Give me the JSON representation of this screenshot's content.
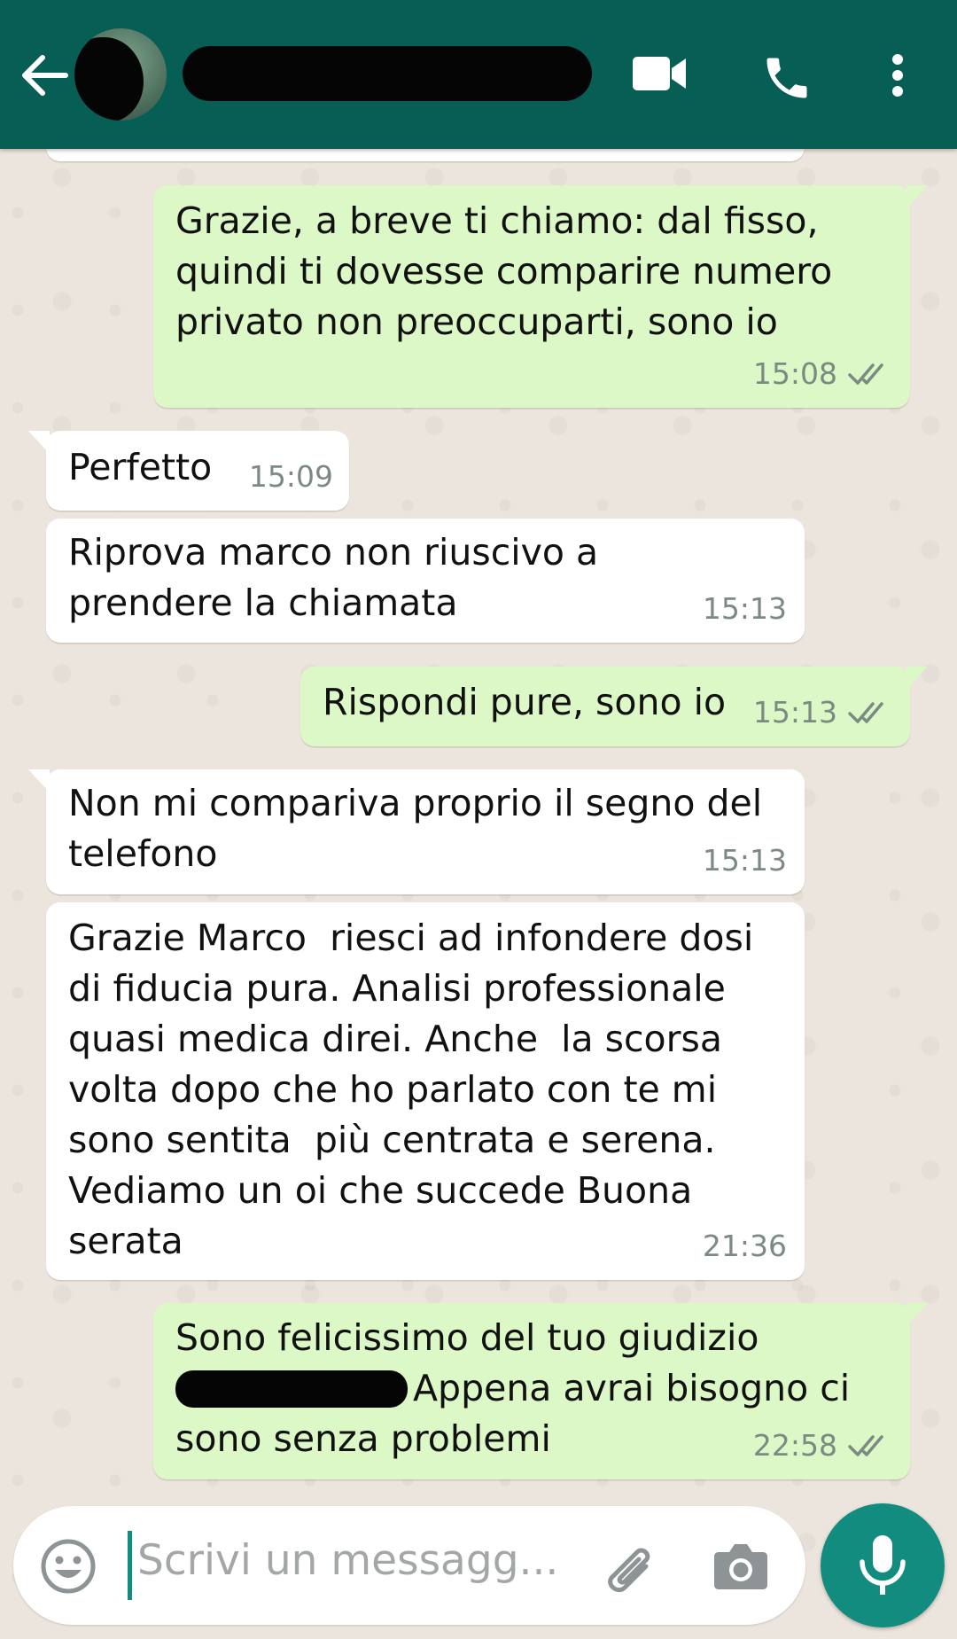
{
  "header": {
    "back_icon": "arrow-back-icon",
    "video_icon": "video-call-icon",
    "call_icon": "phone-icon",
    "menu_icon": "more-vert-icon",
    "colors": {
      "bar": "#075e54",
      "icon": "#ffffff"
    }
  },
  "messages": [
    {
      "direction": "out",
      "lines": [
        "Grazie, a breve ti chiamo: dal fisso,",
        "quindi ti dovesse comparire numero",
        "privato non preoccuparti, sono io"
      ],
      "time": "15:08",
      "status": "read"
    },
    {
      "direction": "in",
      "lines": [
        "Perfetto"
      ],
      "time": "15:09"
    },
    {
      "direction": "in",
      "lines": [
        "Riprova marco non riuscivo a",
        "prendere la chiamata"
      ],
      "time": "15:13"
    },
    {
      "direction": "out",
      "lines": [
        "Rispondi pure, sono io"
      ],
      "time": "15:13",
      "status": "read"
    },
    {
      "direction": "in",
      "lines": [
        "Non mi compariva proprio il segno del",
        "telefono"
      ],
      "time": "15:13"
    },
    {
      "direction": "in",
      "lines": [
        "Grazie Marco  riesci ad infondere dosi",
        "di fiducia pura. Analisi professionale",
        "quasi medica direi. Anche  la scorsa",
        "volta dopo che ho parlato con te mi",
        "sono sentita  più centrata e serena.",
        "Vediamo un oi che succede Buona",
        "serata"
      ],
      "time": "21:36"
    },
    {
      "direction": "out",
      "lines": [
        "Sono felicissimo del tuo giudizio",
        "Appena avrai bisogno ci",
        "sono senza problemi"
      ],
      "time": "22:58",
      "status": "read"
    }
  ],
  "composer": {
    "placeholder": "Scrivi un messagg...",
    "emoji_icon": "emoji-icon",
    "attach_icon": "paperclip-icon",
    "camera_icon": "camera-icon",
    "mic_icon": "microphone-icon"
  },
  "colors": {
    "outgoing_bubble": "#dcf8c6",
    "incoming_bubble": "#ffffff",
    "background": "#ece5dd",
    "accent": "#128c7e",
    "read_ticks": "#7c8a83"
  }
}
